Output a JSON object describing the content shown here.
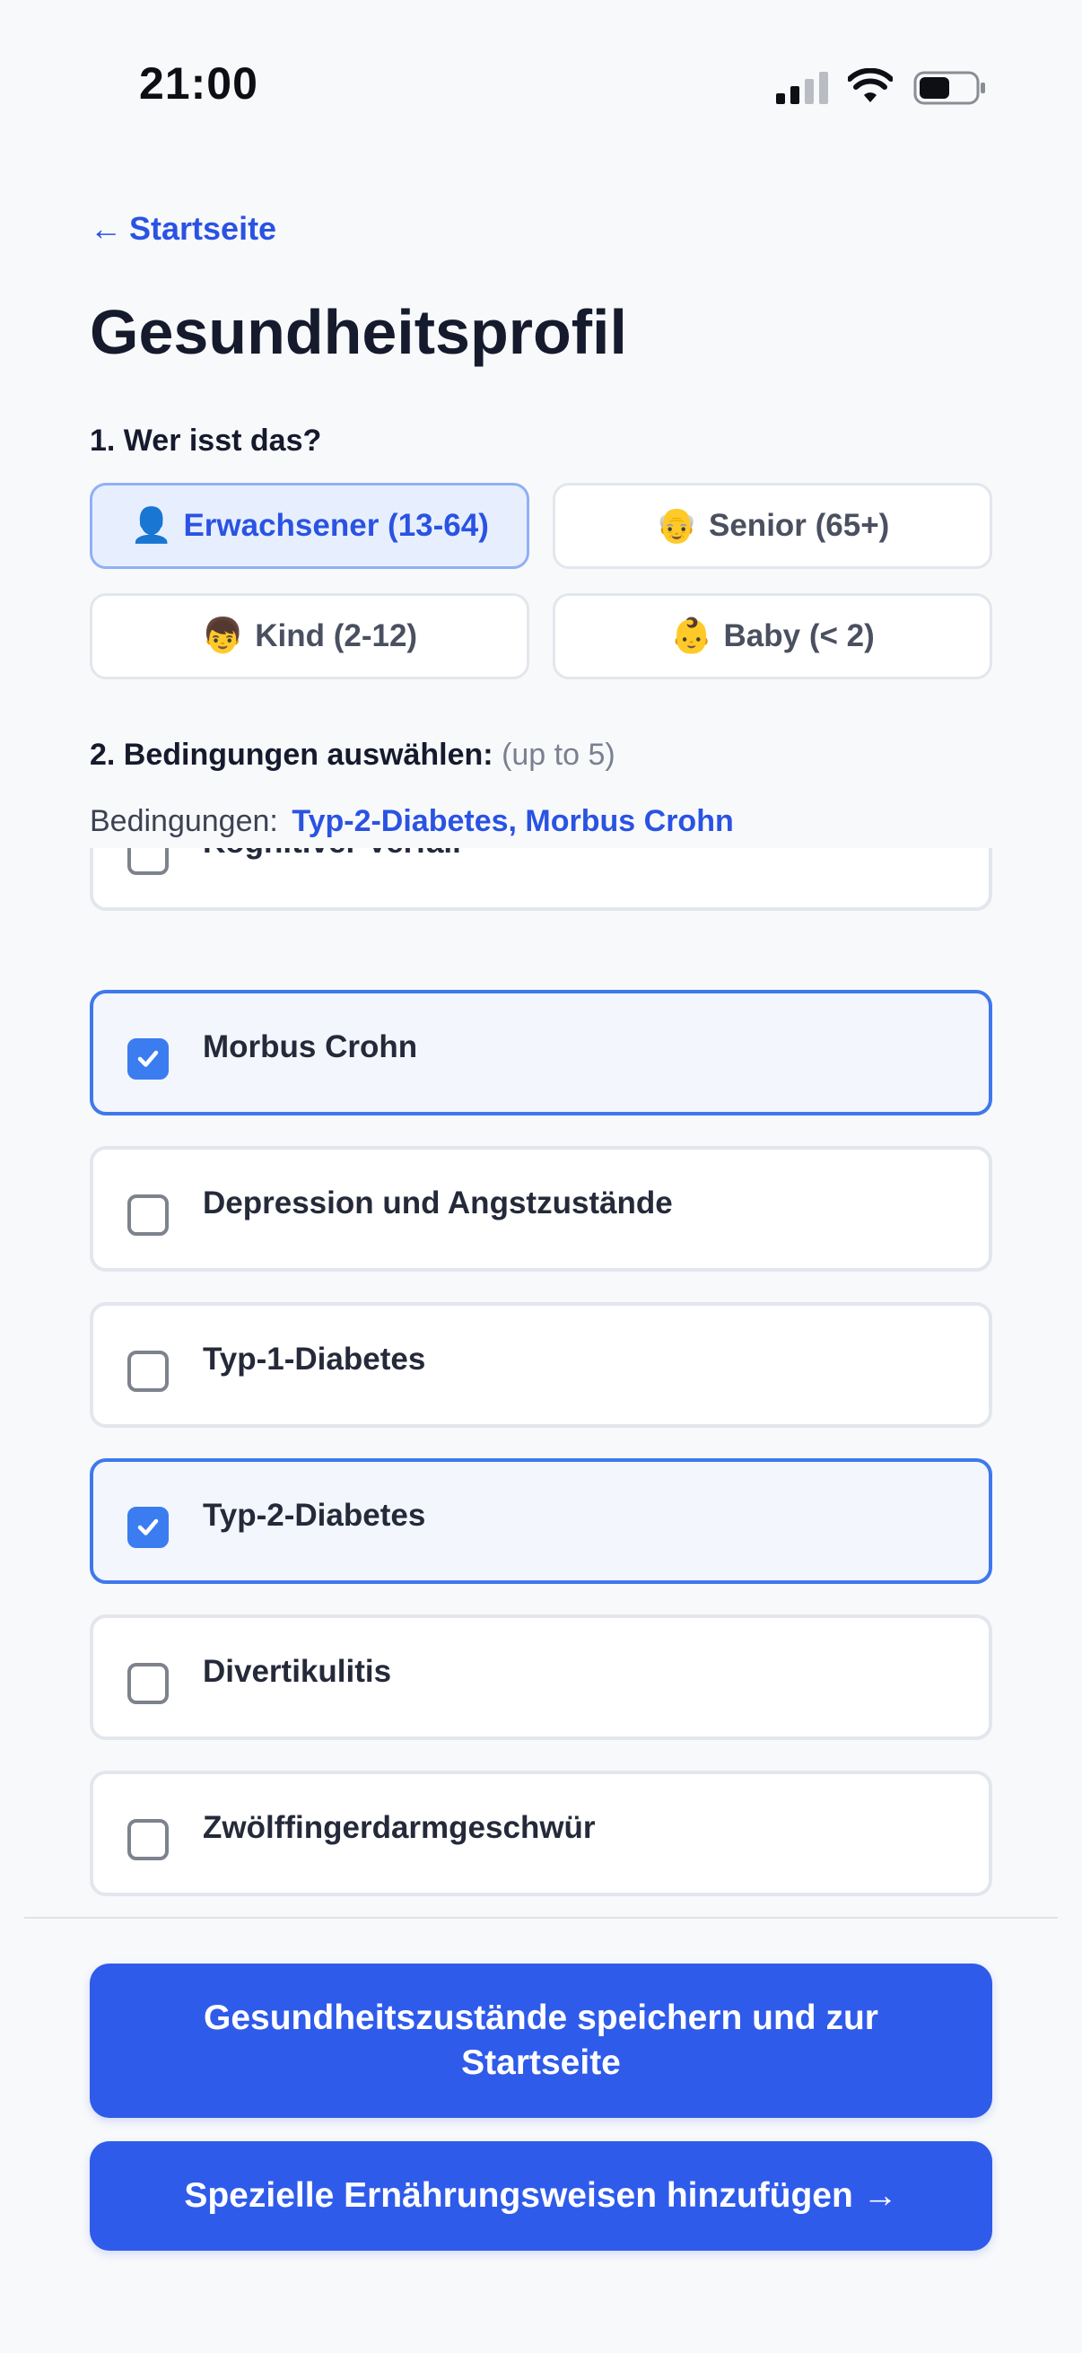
{
  "status_bar": {
    "time": "21:00",
    "signal_icon": "cellular-signal-icon",
    "wifi_icon": "wifi-icon",
    "battery_icon": "battery-icon",
    "battery_level": 0.55
  },
  "nav": {
    "back_arrow": "←",
    "back_label": "Startseite"
  },
  "page_title": "Gesundheitsprofil",
  "section1": {
    "label": "1. Wer isst das?",
    "options": [
      {
        "emoji": "👤",
        "label": "Erwachsener (13-64)",
        "selected": true
      },
      {
        "emoji": "👴",
        "label": "Senior (65+)",
        "selected": false
      },
      {
        "emoji": "👦",
        "label": "Kind (2-12)",
        "selected": false
      },
      {
        "emoji": "👶",
        "label": "Baby (< 2)",
        "selected": false
      }
    ]
  },
  "section2": {
    "label": "2. Bedingungen auswählen:",
    "hint": "(up to 5)",
    "summary_label": "Bedingungen:",
    "summary_value": "Typ-2-Diabetes, Morbus Crohn"
  },
  "conditions": [
    {
      "label": "Kognitiver Verfall",
      "checked": false
    },
    {
      "label": "Morbus Crohn",
      "checked": true
    },
    {
      "label": "Depression und Angstzustände",
      "checked": false
    },
    {
      "label": "Typ-1-Diabetes",
      "checked": false
    },
    {
      "label": "Typ-2-Diabetes",
      "checked": true
    },
    {
      "label": "Divertikulitis",
      "checked": false
    },
    {
      "label": "Zwölffingerdarmgeschwür",
      "checked": false
    }
  ],
  "buttons": {
    "save_line1": "Gesundheitszustände speichern und zur",
    "save_line2": "Startseite",
    "diets": "Spezielle Ernährungsweisen hinzufügen →"
  },
  "colors": {
    "accent": "#2a53e3",
    "primary_button": "#2f5bea",
    "checkbox_checked": "#3b7cf0",
    "selected_border": "#3f78ec"
  }
}
